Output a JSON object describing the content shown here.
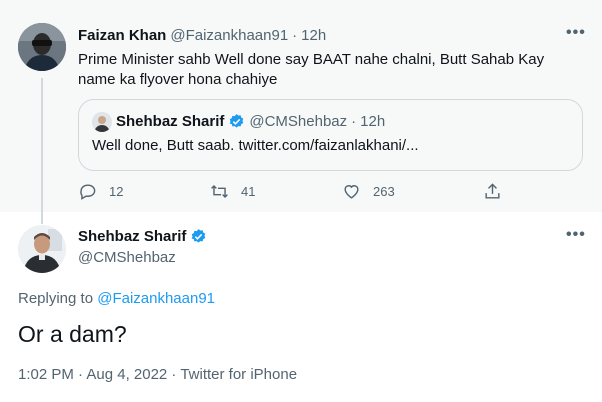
{
  "parent": {
    "author_name": "Faizan Khan",
    "handle": "@Faizankhaan91",
    "separator": "·",
    "time": "12h",
    "text": "Prime Minister sahb Well done say BAAT nahe chalni, Butt Sahab Kay name ka flyover hona chahiye",
    "more": "•••",
    "quoted": {
      "author_name": "Shehbaz Sharif",
      "handle": "@CMShehbaz",
      "separator": "·",
      "time": "12h",
      "text": "Well done, Butt saab. twitter.com/faizanlakhani/..."
    },
    "actions": {
      "reply_count": "12",
      "retweet_count": "41",
      "like_count": "263"
    }
  },
  "main": {
    "author_name": "Shehbaz Sharif",
    "handle": "@CMShehbaz",
    "more": "•••",
    "replying_prefix": "Replying to",
    "replying_to": "@Faizankhaan91",
    "text": "Or a dam?",
    "meta": "1:02 PM · Aug 4, 2022 · Twitter for iPhone"
  },
  "colors": {
    "accent": "#1d9bf0",
    "muted": "#536471",
    "parent_background": "#f7f9f9"
  },
  "icons": [
    "more-icon",
    "verified-badge-icon",
    "reply-icon",
    "retweet-icon",
    "like-icon",
    "share-icon"
  ]
}
